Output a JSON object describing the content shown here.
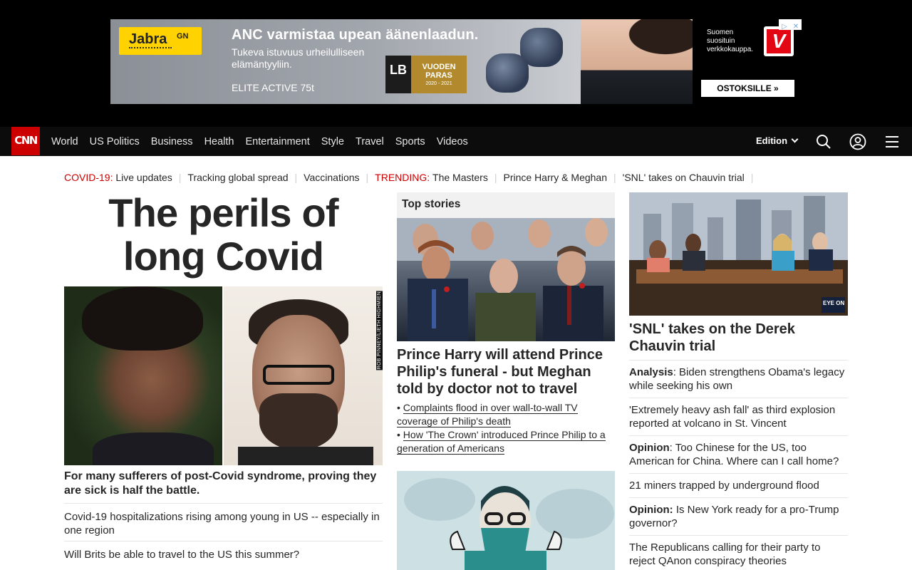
{
  "ad": {
    "brand": "Jabra",
    "brand_suffix": "GN",
    "headline": "ANC varmistaa upean äänenlaadun.",
    "sub": "Tukeva istuvuus urheilulliseen elämäntyyliin.",
    "model": "ELITE ACTIVE 75t",
    "award_left": "LB",
    "award_title": "VUODEN PARAS",
    "award_years": "2020 - 2021",
    "side_text": "Suomen suosituin verkkokauppa.",
    "side_logo": "V",
    "cta": "OSTOKSILLE »",
    "choices_icon": "ad-choices-icon",
    "close_icon": "close-icon"
  },
  "nav": {
    "logo": "CNN",
    "links": [
      "World",
      "US Politics",
      "Business",
      "Health",
      "Entertainment",
      "Style",
      "Travel",
      "Sports",
      "Videos"
    ],
    "edition": "Edition",
    "icons": [
      "search-icon",
      "account-icon",
      "menu-icon"
    ]
  },
  "trending": {
    "covid_label": "COVID-19:",
    "covid_items": [
      "Live updates",
      "Tracking global spread",
      "Vaccinations"
    ],
    "trending_label": "TRENDING:",
    "trending_items": [
      "The Masters",
      "Prince Harry & Meghan",
      "'SNL' takes on Chauvin trial"
    ]
  },
  "left": {
    "title": "The perils of long Covid",
    "image_credit": "ROB PINNEY/LIETH HIGHMIEN",
    "caption": "For many sufferers of post-Covid syndrome, proving they are sick is half the battle.",
    "items": [
      "Covid-19 hospitalizations rising among young in US -- especially in one region",
      "Will Brits be able to travel to the US this summer?"
    ]
  },
  "middle": {
    "section_title": "Top stories",
    "headline": "Prince Harry will attend Prince Philip's funeral - but Meghan told by doctor not to travel",
    "links": [
      "Complaints flood in over wall-to-wall TV coverage of Philip's death",
      "How 'The Crown' introduced Prince Philip to a generation of Americans"
    ]
  },
  "right": {
    "image_badge": "EYE ON MINNESOTA",
    "headline": "'SNL' takes on the Derek Chauvin trial",
    "items": [
      {
        "prefix": "Analysis",
        "text": ": Biden strengthens Obama's legacy while seeking his own"
      },
      {
        "prefix": "",
        "text": "'Extremely heavy ash fall' as third explosion reported at volcano in St. Vincent"
      },
      {
        "prefix": "Opinion",
        "text": ": Too Chinese for the US, too American for China. Where can I call home?"
      },
      {
        "prefix": "",
        "text": "21 miners trapped by underground flood"
      },
      {
        "prefix": "Opinion:",
        "text": " Is New York ready for a pro-Trump governor?"
      },
      {
        "prefix": "",
        "text": "The Republicans calling for their party to reject QAnon conspiracy theories"
      }
    ]
  },
  "colors": {
    "brand_red": "#cc0000",
    "nav_bg": "#0c0c0c",
    "ad_yellow": "#ffd200"
  }
}
